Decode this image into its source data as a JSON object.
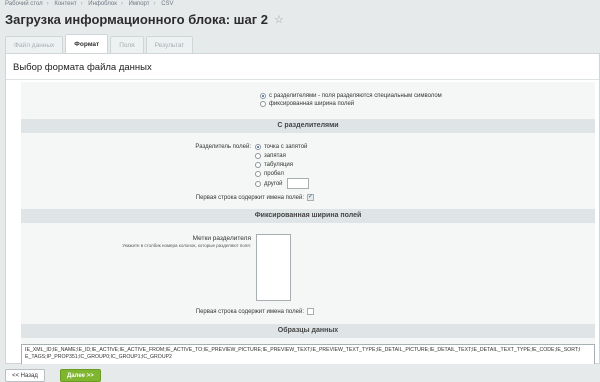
{
  "breadcrumb": [
    "Рабочий стол",
    "Контент",
    "Инфоблок",
    "Импорт",
    "CSV"
  ],
  "title": "Загрузка информационного блока: шаг 2",
  "tabs": [
    "Файл данных",
    "Формат",
    "Поля",
    "Результат"
  ],
  "panel_title": "Выбор формата файла данных",
  "format_options": [
    "с разделителями - поля разделяются специальным символом",
    "фиксированная ширина полей"
  ],
  "section_delim": "С разделителями",
  "delim_label": "Разделитель полей:",
  "delim_options": [
    "точка с запятой",
    "запятая",
    "табуляция",
    "пробел",
    "другой"
  ],
  "first_row_label": "Первая строка содержит имена полей:",
  "section_fixed": "Фиксированная ширина полей",
  "marks_label": "Метки разделителя",
  "marks_hint": "Укажите в столбик номера колонок, которые разделяют поля:",
  "section_samples": "Образцы данных",
  "sample_text": "IE_XML_ID;IE_NAME;IE_ID;IE_ACTIVE;IE_ACTIVE_FROM;IE_ACTIVE_TO;IE_PREVIEW_PICTURE;IE_PREVIEW_TEXT;IE_PREVIEW_TEXT_TYPE;IE_DETAIL_PICTURE;IE_DETAIL_TEXT;IE_DETAIL_TEXT_TYPE;IE_CODE;IE_SORT;IE_TAGS;IP_PROP351;IC_GROUP0;IC_GROUP1;IC_GROUP2",
  "btn_back": "<< Назад",
  "btn_next": "Далее >>"
}
